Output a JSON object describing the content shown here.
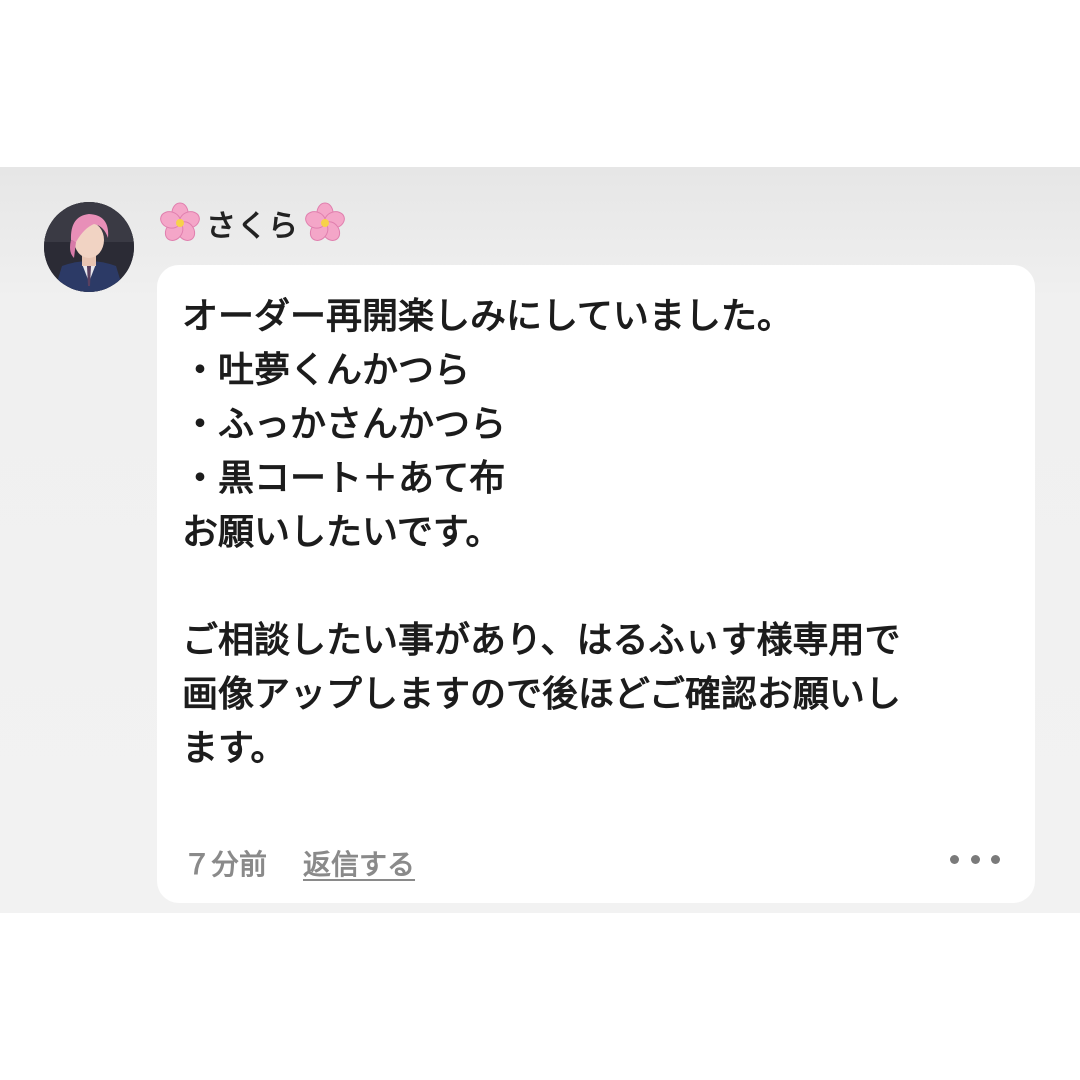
{
  "comment": {
    "username": "さくら",
    "message": "オーダー再開楽しみにしていました。\n・吐夢くんかつら\n・ふっかさんかつら\n・黒コート＋あて布\nお願いしたいです。\n\nご相談したい事があり、はるふぃす様専用で\n画像アップしますので後ほどご確認お願いし\nます。",
    "time": "７分前",
    "reply_label": "返信する"
  },
  "icons": {
    "username_prefix": "cherry-blossom",
    "username_suffix": "cherry-blossom",
    "more": "more-horizontal"
  },
  "colors": {
    "background": "#f2f2f2",
    "bubble": "#ffffff",
    "text": "#1c1c1c",
    "meta": "#8a8a8a",
    "blossom": "#f4a6c8"
  }
}
